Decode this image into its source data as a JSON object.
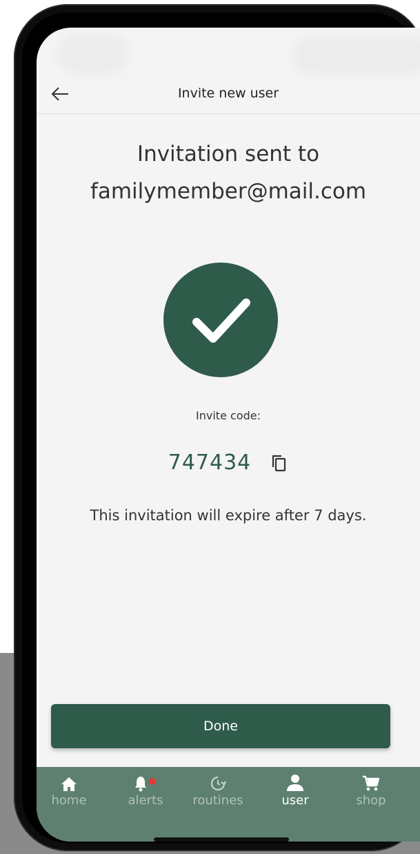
{
  "header": {
    "title": "Invite new user"
  },
  "main": {
    "heading_line1": "Invitation sent to",
    "heading_line2": "familymember@mail.com",
    "code_label": "Invite code:",
    "code_value": "747434",
    "expire_text": "This invitation will expire after 7 days.",
    "done_label": "Done"
  },
  "nav": {
    "items": [
      {
        "label": "home",
        "icon": "home-icon"
      },
      {
        "label": "alerts",
        "icon": "bell-icon"
      },
      {
        "label": "routines",
        "icon": "clock-refresh-icon"
      },
      {
        "label": "user",
        "icon": "user-icon",
        "active": true
      },
      {
        "label": "shop",
        "icon": "cart-icon"
      }
    ]
  },
  "colors": {
    "brand_green": "#2f5b4b",
    "nav_bg": "#5e8070",
    "alert_dot": "#e53935"
  }
}
